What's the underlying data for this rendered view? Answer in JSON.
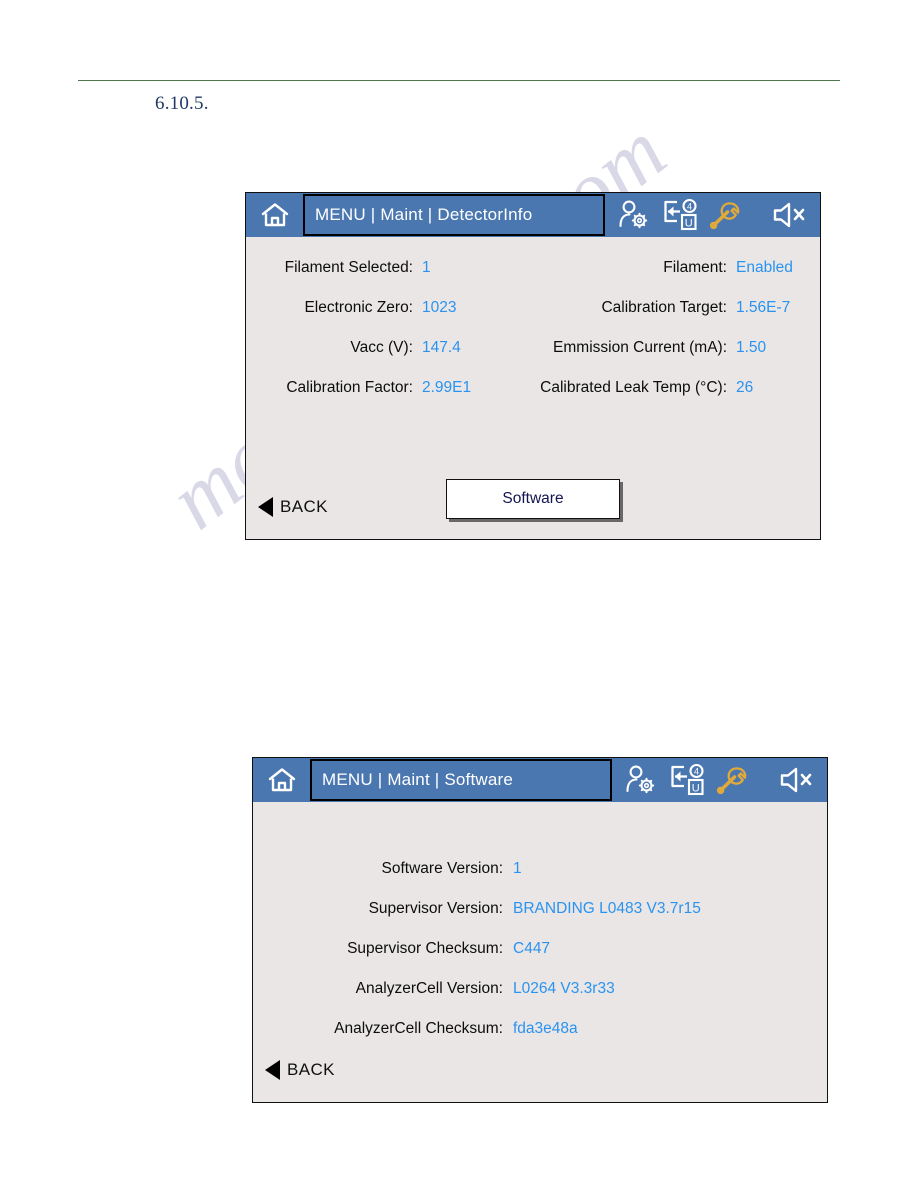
{
  "document": {
    "section_number": "6.10.5."
  },
  "watermark": {
    "text": "manualshive.com"
  },
  "panels": [
    {
      "id": "detector-info",
      "titlebar": {
        "home_icon": "home-icon",
        "breadcrumb": "MENU | Maint | DetectorInfo",
        "icons": [
          {
            "name": "user-settings-icon",
            "glyph": "person-gear"
          },
          {
            "name": "exit-user-icon",
            "glyph": "exit-arrow",
            "badge": "4",
            "sub": "U"
          },
          {
            "name": "wrench-icon",
            "glyph": "wrench"
          },
          {
            "name": "speaker-mute-icon",
            "glyph": "speaker-x"
          }
        ]
      },
      "rows": [
        {
          "left": {
            "label": "Filament Selected:",
            "value": "1"
          },
          "right": {
            "label": "Filament:",
            "value": "Enabled"
          }
        },
        {
          "left": {
            "label": "Electronic Zero:",
            "value": "1023"
          },
          "right": {
            "label": "Calibration Target:",
            "value": "1.56E-7"
          }
        },
        {
          "left": {
            "label": "Vacc (V):",
            "value": "147.4"
          },
          "right": {
            "label": "Emmission Current (mA):",
            "value": "1.50"
          }
        },
        {
          "left": {
            "label": "Calibration Factor:",
            "value": "2.99E1"
          },
          "right": {
            "label": "Calibrated Leak Temp (°C):",
            "value": "26"
          }
        }
      ],
      "button": {
        "label": "Software"
      },
      "back": {
        "label": "BACK"
      }
    },
    {
      "id": "software",
      "titlebar": {
        "home_icon": "home-icon",
        "breadcrumb": "MENU | Maint | Software",
        "icons": [
          {
            "name": "user-settings-icon",
            "glyph": "person-gear"
          },
          {
            "name": "exit-user-icon",
            "glyph": "exit-arrow",
            "badge": "4",
            "sub": "U"
          },
          {
            "name": "wrench-icon",
            "glyph": "wrench"
          },
          {
            "name": "speaker-mute-icon",
            "glyph": "speaker-x"
          }
        ]
      },
      "rows": [
        {
          "label": "Software Version:",
          "value": "1"
        },
        {
          "label": "Supervisor Version:",
          "value": "BRANDING L0483 V3.7r15"
        },
        {
          "label": "Supervisor Checksum:",
          "value": "C447"
        },
        {
          "label": "AnalyzerCell Version:",
          "value": "L0264 V3.3r33"
        },
        {
          "label": "AnalyzerCell Checksum:",
          "value": "fda3e48a"
        }
      ],
      "back": {
        "label": "BACK"
      }
    }
  ],
  "colors": {
    "titlebar_blue": "#4a77b0",
    "screen_bg": "#eae6e6",
    "value_blue": "#2a93f0",
    "label_black": "#0d0d0d",
    "rule_green": "#4d7a4d",
    "section_navy": "#1f3864",
    "wrench_gold": "#e0a93a",
    "button_text": "#141450"
  }
}
